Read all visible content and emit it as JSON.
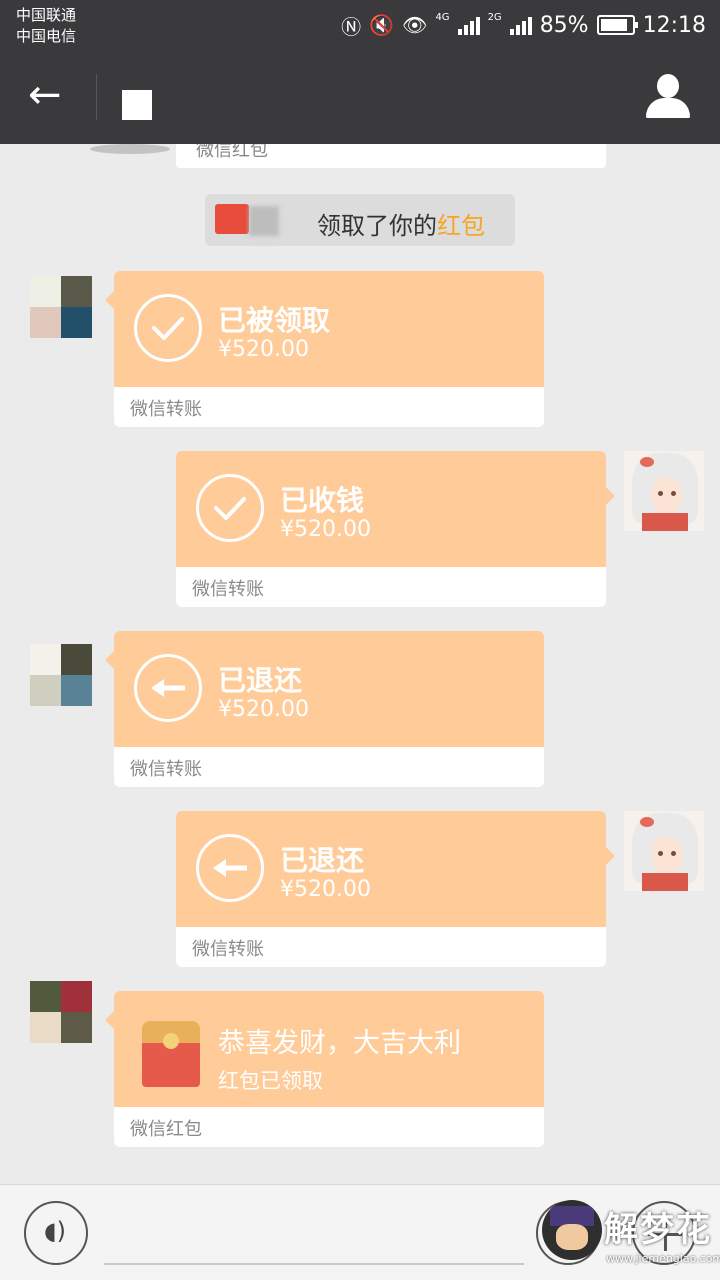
{
  "status_bar": {
    "carrier_1": "中国联通",
    "carrier_2": "中国电信",
    "net_1": "4G",
    "net_2": "2G",
    "battery_pct": "85%",
    "battery_level": 0.85,
    "time": "12:18"
  },
  "nav": {
    "back_icon": "arrow-left-icon",
    "profile_icon": "person-icon"
  },
  "chat": {
    "partial_card_label": "微信红包",
    "system_message": {
      "text": "领取了你的",
      "link": "红包"
    },
    "messages": [
      {
        "side": "left",
        "status": "已被领取",
        "amount": "¥520.00",
        "footer": "微信转账",
        "icon": "check-icon"
      },
      {
        "side": "right",
        "status": "已收钱",
        "amount": "¥520.00",
        "footer": "微信转账",
        "icon": "check-icon"
      },
      {
        "side": "left",
        "status": "已退还",
        "amount": "¥520.00",
        "footer": "微信转账",
        "icon": "return-arrow-icon"
      },
      {
        "side": "right",
        "status": "已退还",
        "amount": "¥520.00",
        "footer": "微信转账",
        "icon": "return-arrow-icon"
      },
      {
        "side": "left",
        "greeting": "恭喜发财，大吉大利",
        "state": "红包已领取",
        "footer": "微信红包",
        "icon": "red-envelope-icon"
      }
    ]
  },
  "input_bar": {
    "voice_icon": "voice-icon",
    "emoji_icon": "emoji-icon",
    "plus_icon": "plus-icon"
  },
  "watermark": {
    "title": "解梦花",
    "url": "www.jiemenglao.com"
  },
  "colors": {
    "transfer_card": "#ffcb99",
    "header": "#3a3a3c",
    "background": "#ebebeb",
    "link_orange": "#f5a623"
  }
}
